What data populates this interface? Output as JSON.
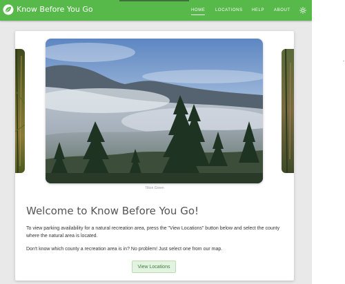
{
  "app": {
    "name": "Know Before You Go"
  },
  "nav": {
    "items": [
      {
        "label": "HOME",
        "active": true
      },
      {
        "label": "LOCATIONS",
        "active": false
      },
      {
        "label": "HELP",
        "active": false
      },
      {
        "label": "ABOUT",
        "active": false
      }
    ],
    "theme_toggle_icon": "sun-icon"
  },
  "carousel": {
    "caption": "Tilton Green"
  },
  "main": {
    "heading": "Welcome to Know Before You Go!",
    "paragraph1": "To view parking availability for a natural recreation area, press the \"View Locations\" button below and select the county where the natural area is located.",
    "paragraph2": "Don't know which county a recreation area is in? No problem! Just select one from our map.",
    "cta_label": "View Locations"
  },
  "colors": {
    "brand": "#56b94a",
    "button_bg": "#e3f3e1",
    "button_text": "#3d7a38"
  }
}
